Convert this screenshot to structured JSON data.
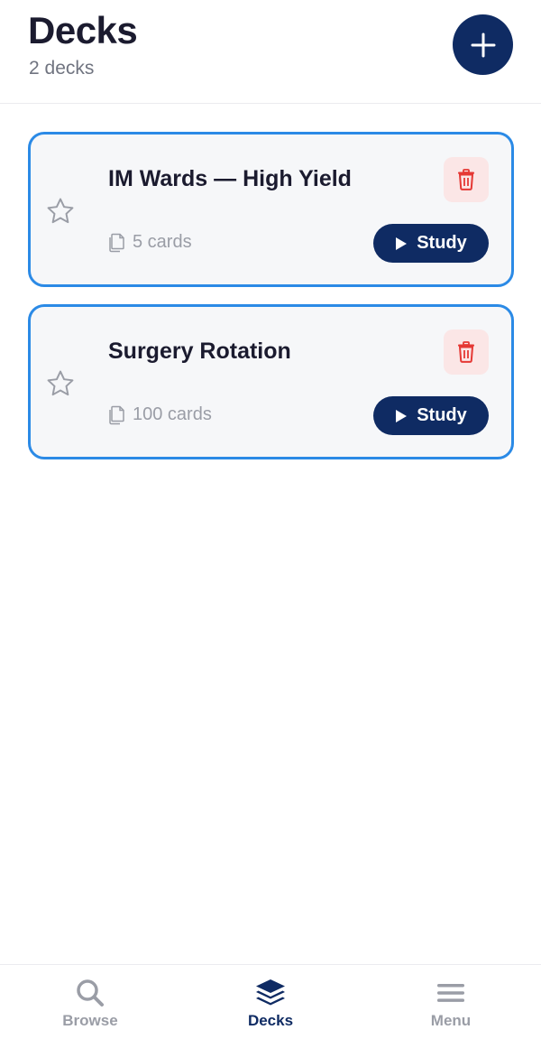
{
  "header": {
    "title": "Decks",
    "subtitle": "2 decks",
    "add_icon": "plus-icon"
  },
  "decks": [
    {
      "title": "IM Wards — High Yield",
      "count_label": "5 cards",
      "study_label": "Study",
      "starred": false
    },
    {
      "title": "Surgery Rotation",
      "count_label": "100 cards",
      "study_label": "Study",
      "starred": false
    }
  ],
  "nav": {
    "items": [
      {
        "label": "Browse",
        "icon": "search-icon",
        "active": false
      },
      {
        "label": "Decks",
        "icon": "layers-icon",
        "active": true
      },
      {
        "label": "Menu",
        "icon": "hamburger-menu-icon",
        "active": false
      }
    ]
  },
  "colors": {
    "brand": "#0f2b63",
    "card_border": "#2b8ae6",
    "card_bg": "#f6f7f9",
    "delete_bg": "#fbe6e6",
    "delete_icon": "#e53935",
    "muted": "#9a9da6"
  }
}
